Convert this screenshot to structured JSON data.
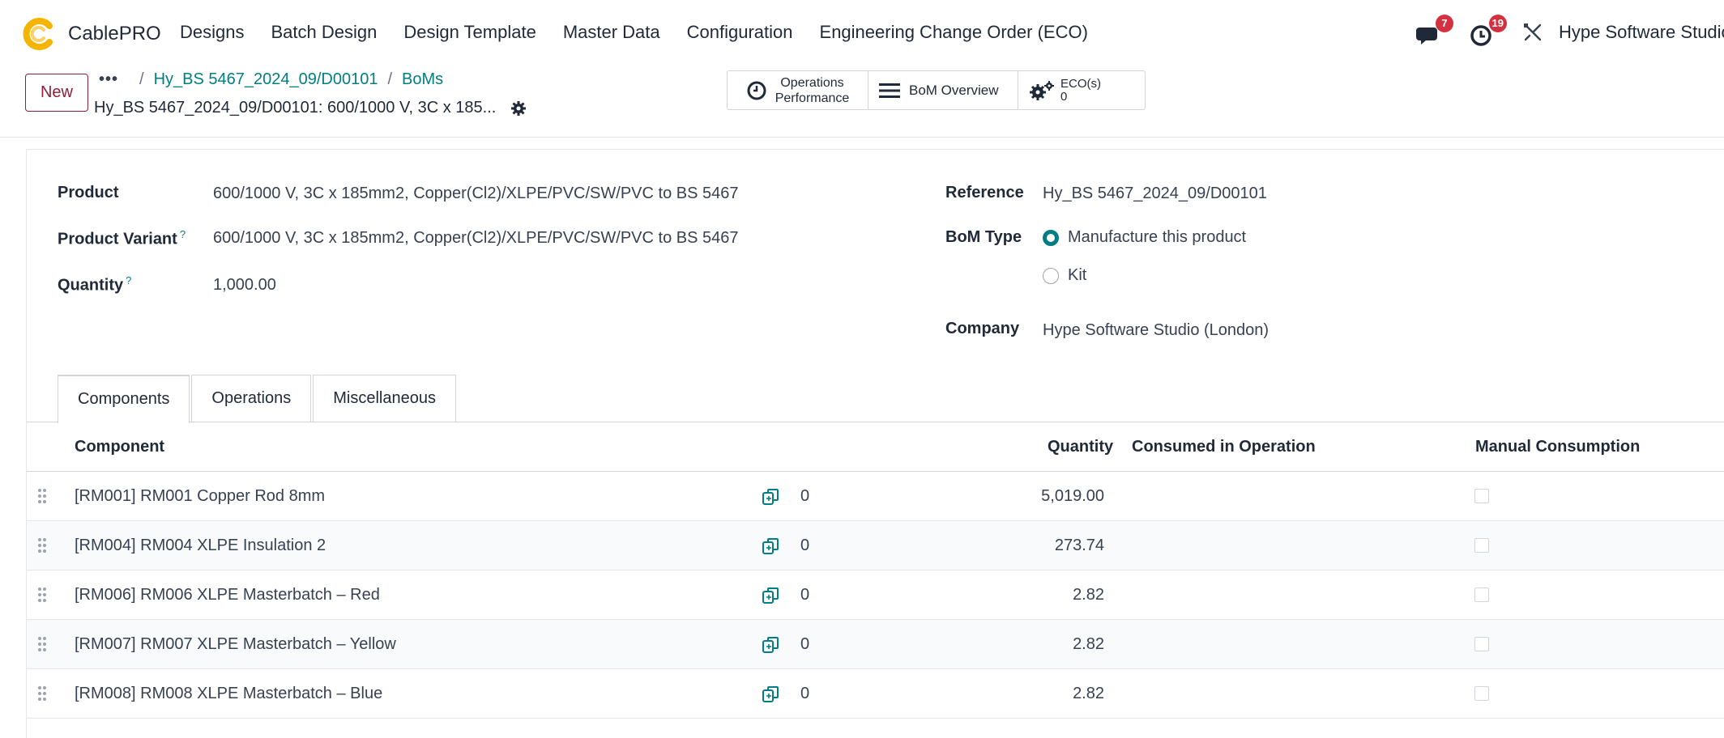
{
  "app": {
    "brand": "CablePRO",
    "menu": [
      "Designs",
      "Batch Design",
      "Design Template",
      "Master Data",
      "Configuration",
      "Engineering Change Order (ECO)"
    ],
    "messages_count": "7",
    "activities_count": "19",
    "company": "Hype Software Studio",
    "brand_color": "#f4b400",
    "accent_color": "#017e84",
    "primary_color": "#8d1f3b"
  },
  "control_panel": {
    "new_label": "New",
    "breadcrumb_dots": "•••",
    "breadcrumb": [
      "Hy_BS 5467_2024_09/D00101",
      "BoMs"
    ],
    "record_title": "Hy_BS 5467_2024_09/D00101: 600/1000 V, 3C x 185...",
    "smart_buttons": {
      "operations_line1": "Operations",
      "operations_line2": "Performance",
      "bom_overview": "BoM Overview",
      "eco_label": "ECO(s)",
      "eco_count": "0"
    }
  },
  "form": {
    "product_label": "Product",
    "product_value": "600/1000 V, 3C x 185mm2, Copper(Cl2)/XLPE/PVC/SW/PVC to BS 5467",
    "variant_label": "Product Variant",
    "variant_value": "600/1000 V, 3C x 185mm2, Copper(Cl2)/XLPE/PVC/SW/PVC to BS 5467",
    "quantity_label": "Quantity",
    "quantity_value": "1,000.00",
    "help_mark": "?",
    "reference_label": "Reference",
    "reference_value": "Hy_BS 5467_2024_09/D00101",
    "bom_type_label": "BoM Type",
    "bom_type_options": [
      "Manufacture this product",
      "Kit"
    ],
    "bom_type_selected": "Manufacture this product",
    "company_label": "Company",
    "company_value": "Hype Software Studio (London)"
  },
  "tabs": [
    "Components",
    "Operations",
    "Miscellaneous"
  ],
  "active_tab": "Components",
  "table": {
    "headers": {
      "component": "Component",
      "quantity": "Quantity",
      "consumed": "Consumed in Operation",
      "manual": "Manual Consumption"
    },
    "rows": [
      {
        "component": "[RM001] RM001 Copper Rod 8mm",
        "count": "0",
        "quantity": "5,019.00",
        "manual": false
      },
      {
        "component": "[RM004] RM004 XLPE Insulation 2",
        "count": "0",
        "quantity": "273.74",
        "manual": false
      },
      {
        "component": "[RM006] RM006 XLPE Masterbatch – Red",
        "count": "0",
        "quantity": "2.82",
        "manual": false
      },
      {
        "component": "[RM007] RM007 XLPE Masterbatch – Yellow",
        "count": "0",
        "quantity": "2.82",
        "manual": false
      },
      {
        "component": "[RM008] RM008 XLPE Masterbatch – Blue",
        "count": "0",
        "quantity": "2.82",
        "manual": false
      }
    ]
  }
}
